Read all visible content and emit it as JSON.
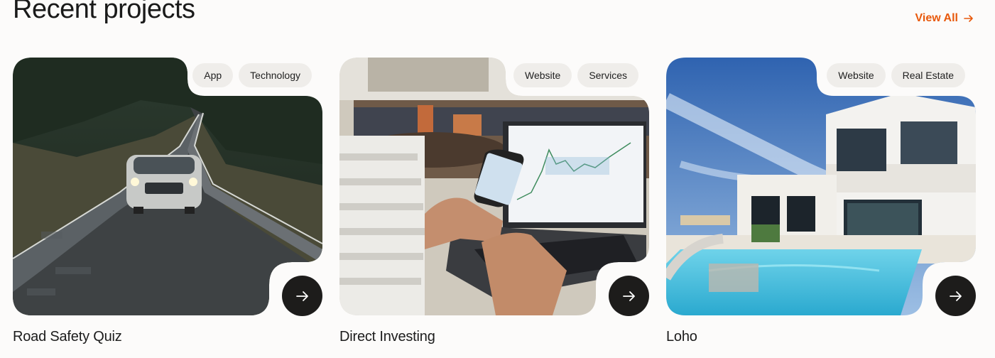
{
  "section": {
    "title": "Recent projects",
    "view_all_label": "View All",
    "accent_color": "#e8590c"
  },
  "projects": [
    {
      "title": "Road Safety Quiz",
      "tags": [
        "App",
        "Technology"
      ],
      "image": "car-on-mountain-road-photo"
    },
    {
      "title": "Direct Investing",
      "tags": [
        "Website",
        "Services"
      ],
      "image": "laptop-trading-chart-photo"
    },
    {
      "title": "Loho",
      "tags": [
        "Website",
        "Real Estate"
      ],
      "image": "modern-villa-pool-photo"
    }
  ],
  "icons": {
    "card_button": "arrow-right-icon",
    "view_all": "arrow-right-icon"
  }
}
